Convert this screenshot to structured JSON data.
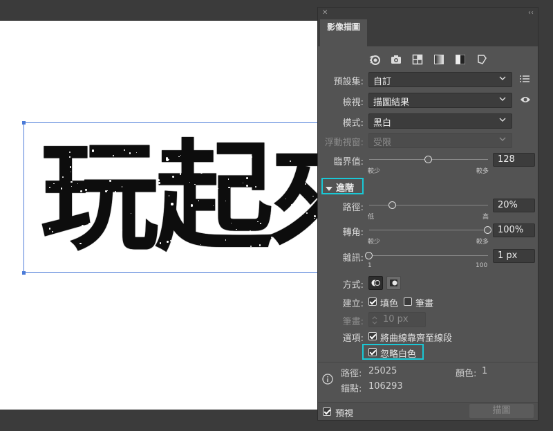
{
  "artboard": {
    "text": "玩起來"
  },
  "panel": {
    "title": "影像描圖",
    "close_glyph": "✕",
    "collapse_glyph": "‹‹",
    "tools": [
      {
        "name": "auto-color-icon"
      },
      {
        "name": "camera-icon"
      },
      {
        "name": "grid-icon"
      },
      {
        "name": "grayscale-icon"
      },
      {
        "name": "black-white-icon"
      },
      {
        "name": "outline-icon"
      }
    ],
    "preset": {
      "label": "預設集:",
      "value": "自訂"
    },
    "view": {
      "label": "檢視:",
      "value": "描圖結果"
    },
    "mode": {
      "label": "模式:",
      "value": "黑白"
    },
    "palette": {
      "label": "浮動視窗:",
      "value": "受限"
    },
    "threshold": {
      "label": "臨界值:",
      "value": "128",
      "min_label": "較少",
      "max_label": "較多",
      "level": 0.5
    },
    "advanced": {
      "label": "進階"
    },
    "paths": {
      "label": "路徑:",
      "value": "20%",
      "min_label": "低",
      "max_label": "高",
      "level": 0.2
    },
    "corners": {
      "label": "轉角:",
      "value": "100%",
      "min_label": "較少",
      "max_label": "較多",
      "level": 1.0
    },
    "noise": {
      "label": "雜訊:",
      "value": "1 px",
      "min_label": "1",
      "max_label": "100",
      "level": 0.0
    },
    "method": {
      "label": "方式:"
    },
    "create": {
      "label": "建立:",
      "fill_label": "填色",
      "fill_checked": true,
      "stroke_label": "筆畫",
      "stroke_checked": false
    },
    "stroke": {
      "label": "筆畫:",
      "value": "10 px"
    },
    "options": {
      "label": "選項:",
      "snap_label": "將曲線靠齊至線段",
      "snap_checked": true,
      "ignore_white_label": "忽略白色",
      "ignore_white_checked": true
    },
    "stats": {
      "paths_label": "路徑:",
      "paths_value": "25025",
      "colors_label": "顏色:",
      "colors_value": "1",
      "anchors_label": "錨點:",
      "anchors_value": "106293"
    },
    "preview": {
      "label": "預視",
      "checked": true
    },
    "trace_button": "描圖"
  },
  "colors": {
    "accent_highlight": "#19c8d6",
    "selection": "#4b7bd8",
    "panel_bg": "#535353"
  }
}
